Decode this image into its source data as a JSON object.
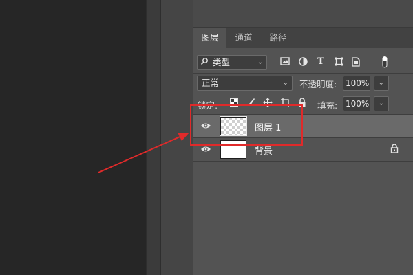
{
  "colors": {
    "annotation": "#e02a2a",
    "selected_layer": "#6a6a6a",
    "panel": "#535353"
  },
  "tabs": [
    {
      "label": "图层",
      "active": true
    },
    {
      "label": "通道",
      "active": false
    },
    {
      "label": "路径",
      "active": false
    }
  ],
  "filter": {
    "kind_value": "类型",
    "icons": [
      "image-filter-icon",
      "adjustment-filter-icon",
      "type-filter-icon",
      "shape-filter-icon",
      "smart-object-filter-icon",
      "filter-toggle-icon"
    ]
  },
  "blend": {
    "mode_value": "正常",
    "opacity_label": "不透明度:",
    "opacity_value": "100%"
  },
  "lock": {
    "label": "锁定:",
    "fill_label": "填充:",
    "fill_value": "100%"
  },
  "layers": [
    {
      "name": "图层 1",
      "selected": true,
      "thumbnail": "transparent",
      "locked": false
    },
    {
      "name": "背景",
      "selected": false,
      "thumbnail": "white",
      "locked": true
    }
  ]
}
